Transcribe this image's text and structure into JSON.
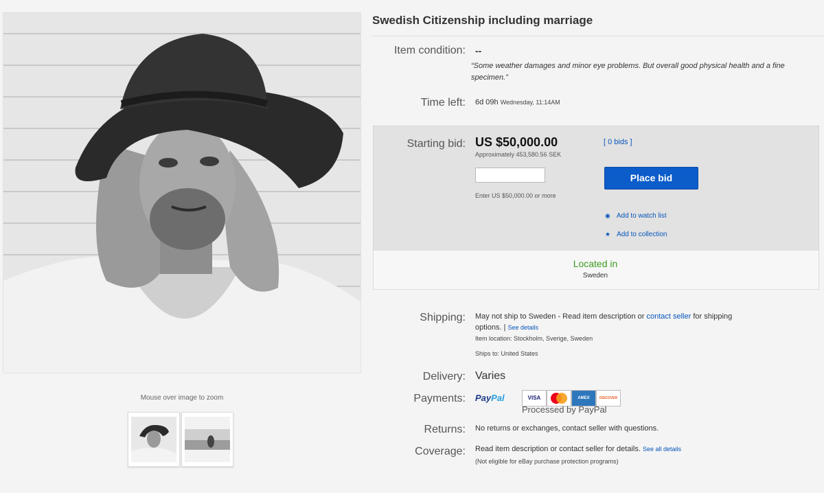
{
  "image": {
    "zoom_hint": "Mouse over image to zoom"
  },
  "item": {
    "title": "Swedish Citizenship including marriage",
    "condition_label": "Item condition:",
    "condition_value": "--",
    "condition_note": "“Some weather damages and minor eye problems. But overall good physical health and a fine specimen.”",
    "time_left_label": "Time left:",
    "time_left_value": "6d 09h",
    "time_left_detail": "Wednesday, 11:14AM"
  },
  "bid": {
    "starting_label": "Starting bid:",
    "price": "US $50,000.00",
    "bids_link": "[ 0 bids ]",
    "approx": "Approximately 453,580.56 SEK",
    "input_value": "",
    "enter_hint": "Enter US $50,000.00 or more",
    "place_bid_label": "Place bid",
    "watch_label": "Add to watch list",
    "collection_label": "Add to collection",
    "located_label": "Located in",
    "located_value": "Sweden"
  },
  "shipping": {
    "label": "Shipping:",
    "text_before": "May not ship to Sweden - Read item description or",
    "contact_link": "contact seller",
    "text_after": "for shipping",
    "text_line2": "options. |",
    "see_details": "See details",
    "item_location": "Item location: Stockholm, Sverige, Sweden",
    "ships_to": "Ships to: United States"
  },
  "delivery": {
    "label": "Delivery:",
    "value": "Varies"
  },
  "payments": {
    "label": "Payments:",
    "paypal_part1": "Pay",
    "paypal_part2": "Pal",
    "card_visa": "VISA",
    "card_amex": "AMEX",
    "card_discover": "DISCOVER",
    "processed": "Processed by PayPal"
  },
  "returns": {
    "label": "Returns:",
    "value": "No returns or exchanges, contact seller with questions."
  },
  "coverage": {
    "label": "Coverage:",
    "value": "Read item description or contact seller for details.",
    "see_all": "See all details",
    "note": "(Not eligible for eBay purchase protection programs)"
  },
  "colors": {
    "accent_blue": "#0c5cc9",
    "link_blue": "#0654ba",
    "located_green": "#3a9c1e"
  }
}
